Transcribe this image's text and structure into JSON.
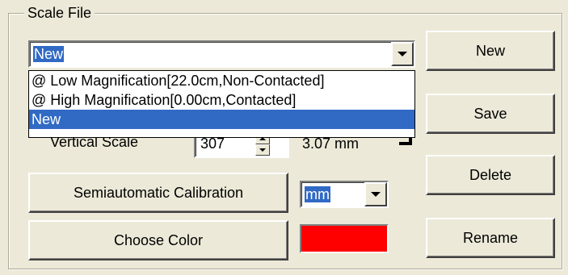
{
  "group": {
    "title": "Scale File"
  },
  "scale_select": {
    "value": "New",
    "options": [
      "@ Low Magnification[22.0cm,Non-Contacted]",
      "@ High Magnification[0.00cm,Contacted]",
      "New"
    ]
  },
  "vertical": {
    "label": "Vertical Scale",
    "value": "307",
    "mm": "3.07 mm"
  },
  "buttons": {
    "new": "New",
    "save": "Save",
    "delete": "Delete",
    "rename": "Rename",
    "semiauto": "Semiautomatic Calibration",
    "choose_color": "Choose Color"
  },
  "unit_select": {
    "value": "mm"
  },
  "colors": {
    "swatch": "#ff0000",
    "selection": "#316ac5"
  }
}
